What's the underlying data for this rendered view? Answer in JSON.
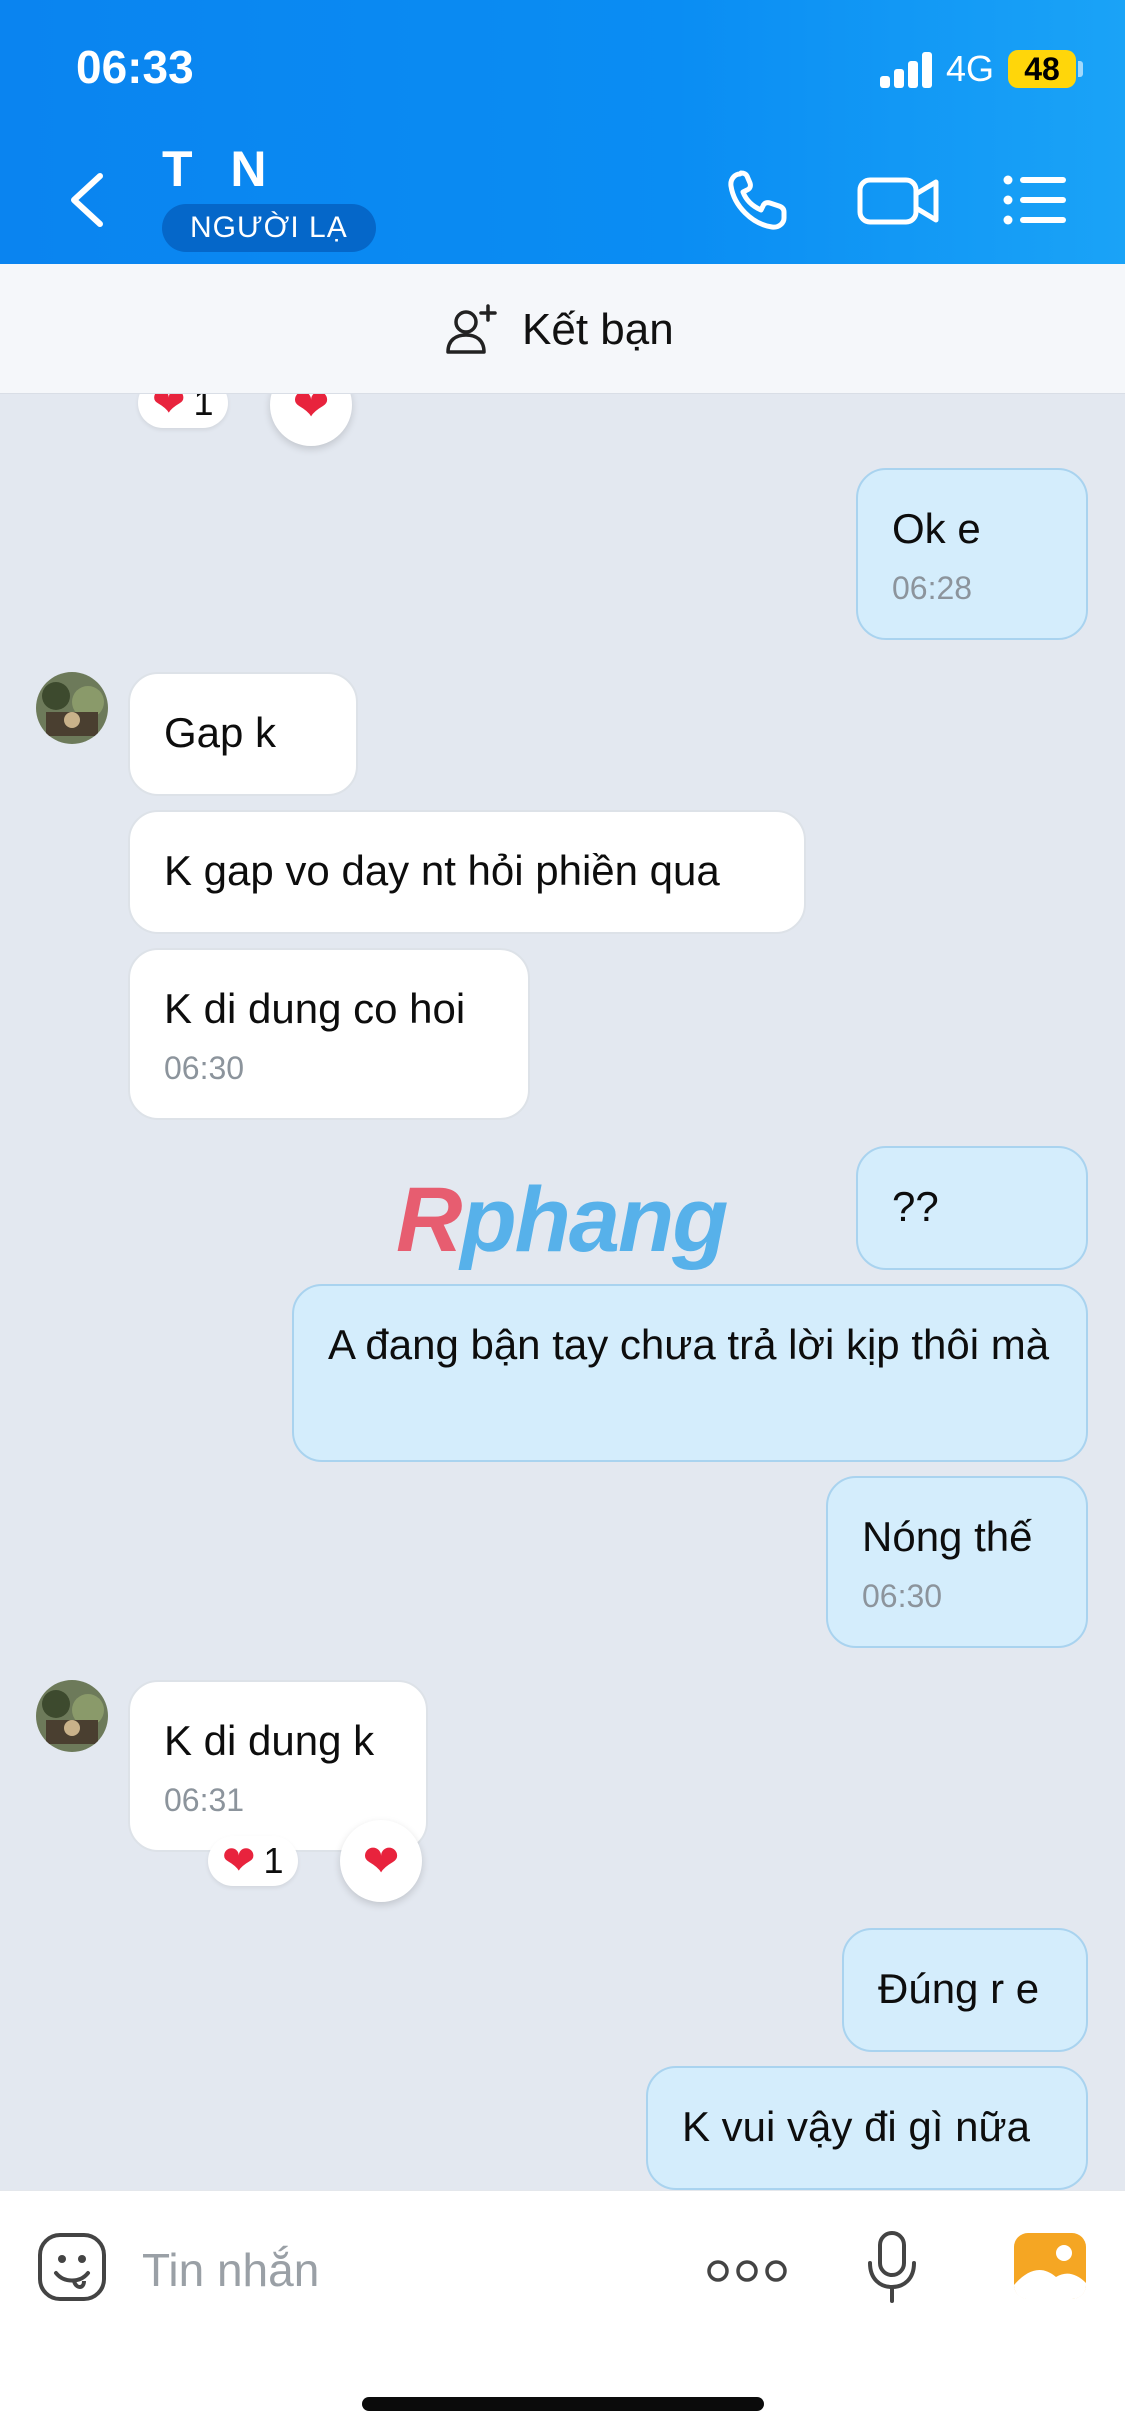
{
  "status_bar": {
    "time": "06:33",
    "network": "4G",
    "battery": "48"
  },
  "header": {
    "contact_name": "T N",
    "badge": "NGƯỜI LẠ",
    "icons": [
      "back-icon",
      "phone-icon",
      "video-call-icon",
      "menu-list-icon"
    ]
  },
  "friend_bar": {
    "label": "Kết bạn",
    "icon": "add-person-icon"
  },
  "top_reaction": {
    "count": "1"
  },
  "messages": [
    {
      "dir": "out",
      "text": "Ok e",
      "time": "06:28"
    },
    {
      "dir": "in",
      "text": "Gap k"
    },
    {
      "dir": "in",
      "text": "K gap vo day nt hỏi phiền qua"
    },
    {
      "dir": "in",
      "text": "K di dung co hoi",
      "time": "06:30"
    },
    {
      "dir": "out",
      "text": "??"
    },
    {
      "dir": "out",
      "text": "A đang bận tay chưa trả lời kịp thôi mà"
    },
    {
      "dir": "out",
      "text": "Nóng thế",
      "time": "06:30"
    },
    {
      "dir": "in",
      "text": "K di dung k",
      "time": "06:31",
      "reaction_count": "1"
    },
    {
      "dir": "out",
      "text": "Đúng r e"
    },
    {
      "dir": "out",
      "text": "K vui vậy đi gì nữa"
    }
  ],
  "watermark": {
    "first": "R",
    "rest": "phang"
  },
  "input_bar": {
    "placeholder": "Tin nhắn",
    "icons": [
      "sticker-icon",
      "more-icon",
      "microphone-icon",
      "image-icon"
    ]
  },
  "colors": {
    "header": "#0a84f0",
    "bubble_out": "#d4edfc",
    "bubble_in": "#ffffff",
    "background": "#e3e8f0",
    "heart": "#e8233d"
  }
}
